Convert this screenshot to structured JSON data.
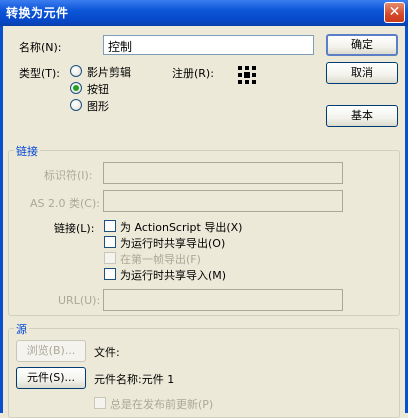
{
  "window": {
    "title": "转换为元件",
    "close_glyph": "✕"
  },
  "name": {
    "label": "名称(N):",
    "value": "控制"
  },
  "type": {
    "label": "类型(T):",
    "options": [
      {
        "label": "影片剪辑",
        "selected": false
      },
      {
        "label": "按钮",
        "selected": true
      },
      {
        "label": "图形",
        "selected": false
      }
    ]
  },
  "registration": {
    "label": "注册(R):",
    "icon": "registration-grid-icon"
  },
  "buttons": {
    "ok": "确定",
    "cancel": "取消",
    "basic": "基本"
  },
  "linkage": {
    "title": "链接",
    "identifier_label": "标识符(I):",
    "identifier_value": "",
    "as_class_label": "AS 2.0 类(C):",
    "as_class_value": "",
    "linkage_label": "链接(L):",
    "options": [
      {
        "label": "为 ActionScript 导出(X)",
        "checked": false,
        "enabled": true
      },
      {
        "label": "为运行时共享导出(O)",
        "checked": false,
        "enabled": true
      },
      {
        "label": "在第一帧导出(F)",
        "checked": false,
        "enabled": false
      },
      {
        "label": "为运行时共享导入(M)",
        "checked": false,
        "enabled": true
      }
    ],
    "url_label": "URL(U):",
    "url_value": ""
  },
  "source": {
    "title": "源",
    "browse_button": "浏览(B)...",
    "file_label": "文件:",
    "symbol_button": "元件(S)...",
    "symbol_name_label": "元件名称:元件 1",
    "always_update_label": "总是在发布前更新(P)"
  },
  "colors": {
    "titlebar": "#0648c8",
    "group_title": "#0046d5",
    "face": "#ece9d8"
  }
}
